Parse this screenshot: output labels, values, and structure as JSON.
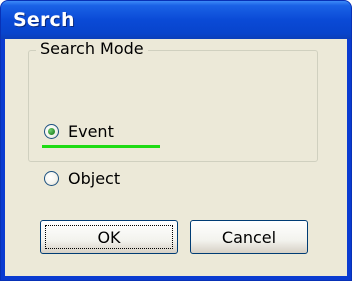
{
  "window": {
    "title": "Serch"
  },
  "search_mode": {
    "label": "Search Mode",
    "options": [
      {
        "label": "Event",
        "selected": true
      },
      {
        "label": "Object",
        "selected": false
      }
    ]
  },
  "buttons": {
    "ok_label": "OK",
    "cancel_label": "Cancel"
  },
  "colors": {
    "titlebar_blue": "#0a4ad6",
    "dialog_face": "#ece9d8",
    "highlight_underline": "#1edc14",
    "radio_dot": "#2a8c2a"
  }
}
